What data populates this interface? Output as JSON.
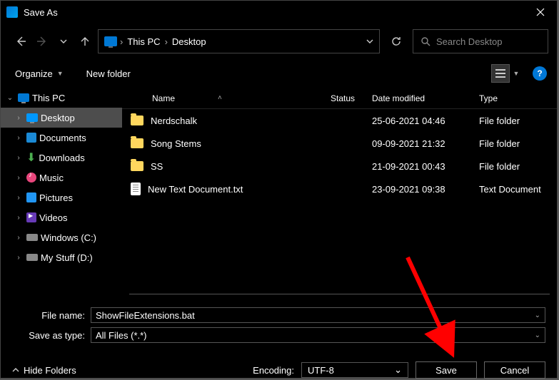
{
  "title": "Save As",
  "breadcrumb": {
    "root": "This PC",
    "leaf": "Desktop"
  },
  "search": {
    "placeholder": "Search Desktop"
  },
  "toolbar": {
    "organize": "Organize",
    "newfolder": "New folder"
  },
  "columns": {
    "name": "Name",
    "status": "Status",
    "date": "Date modified",
    "type": "Type"
  },
  "tree": {
    "root": "This PC",
    "items": [
      {
        "label": "Desktop"
      },
      {
        "label": "Documents"
      },
      {
        "label": "Downloads"
      },
      {
        "label": "Music"
      },
      {
        "label": "Pictures"
      },
      {
        "label": "Videos"
      },
      {
        "label": "Windows (C:)"
      },
      {
        "label": "My Stuff (D:)"
      }
    ]
  },
  "files": [
    {
      "name": "Nerdschalk",
      "date": "25-06-2021 04:46",
      "type": "File folder",
      "kind": "folder"
    },
    {
      "name": "Song Stems",
      "date": "09-09-2021 21:32",
      "type": "File folder",
      "kind": "folder"
    },
    {
      "name": "SS",
      "date": "21-09-2021 00:43",
      "type": "File folder",
      "kind": "folder"
    },
    {
      "name": "New Text Document.txt",
      "date": "23-09-2021 09:38",
      "type": "Text Document",
      "kind": "txt"
    }
  ],
  "form": {
    "filename_label": "File name:",
    "filename_value": "ShowFileExtensions.bat",
    "saveastype_label": "Save as type:",
    "saveastype_value": "All Files  (*.*)"
  },
  "footer": {
    "hidefolders": "Hide Folders",
    "encoding_label": "Encoding:",
    "encoding_value": "UTF-8",
    "save": "Save",
    "cancel": "Cancel"
  }
}
